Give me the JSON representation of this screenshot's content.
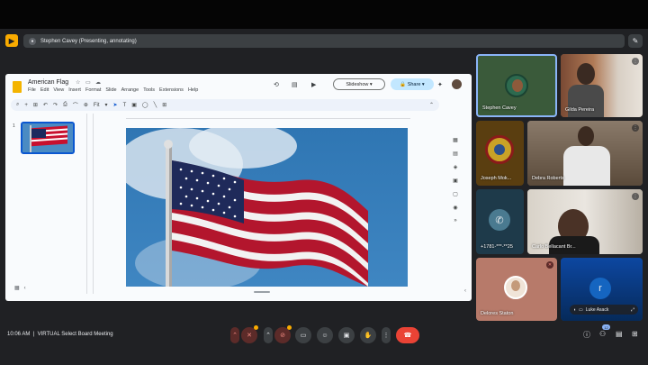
{
  "presenting_banner": {
    "text": "Stephen Cavey (Presenting, annotating)"
  },
  "slides_app": {
    "doc_title": "American Flag",
    "menu": [
      "File",
      "Edit",
      "View",
      "Insert",
      "Format",
      "Slide",
      "Arrange",
      "Tools",
      "Extensions",
      "Help"
    ],
    "slideshow_label": "Slideshow",
    "share_label": "Share",
    "zoom_label": "Fit",
    "slide_number": "1"
  },
  "participants": [
    {
      "name": "Stephen Cavey"
    },
    {
      "name": "Gilda Pereira"
    },
    {
      "name": "Joseph Mok..."
    },
    {
      "name": "Debra Roberts"
    },
    {
      "name": "+1781-***-**25"
    },
    {
      "name": "Carlo Bellacant Br..."
    },
    {
      "name": "Delores Staton"
    },
    {
      "name": "Luke Asack",
      "initial": "r"
    }
  ],
  "meeting": {
    "time": "10:06 AM",
    "title": "VIRTUAL Select Board Meeting",
    "participant_count": "12"
  },
  "colors": {
    "accent": "#8ab4f8",
    "hangup": "#ea4335",
    "presenting": "#f9ab00",
    "active_speaker_border": "#8ab4f8"
  }
}
